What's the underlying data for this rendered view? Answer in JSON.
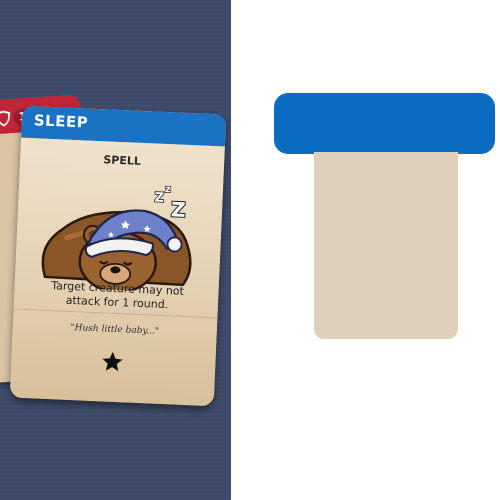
{
  "colors": {
    "board": "#3d4a69",
    "spell_header": "#1a72c4",
    "creature_header": "#c0263a",
    "parchment": "#e8d7bd",
    "slot_header": "#0a6cc0",
    "slot_body": "#ded0bc"
  },
  "hand": {
    "back_card": {
      "cost": "1",
      "icon": "shield-icon"
    },
    "spell_card": {
      "title": "SLEEP",
      "type": "SPELL",
      "art_icon": "sleeping-bear-icon",
      "zzz": "Z Z",
      "rules_text": "Target creature may not attack for 1 round.",
      "flavor_text": "\"Hush little baby...\"",
      "rarity_icon": "star-icon"
    }
  },
  "target_slot": {
    "header_label": "",
    "body_label": ""
  }
}
